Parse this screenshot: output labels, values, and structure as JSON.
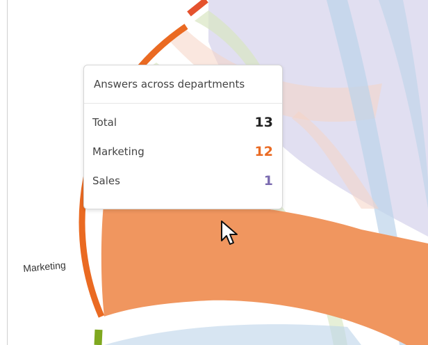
{
  "chart": {
    "arc_labels": [
      {
        "key": "marketing",
        "text": "Marketing"
      }
    ],
    "colors": {
      "marketing": "#ea6a22",
      "marketing_ribbon": "#f0965f",
      "sales": "#7b6bb0",
      "sales_ribbon": "#dcd9ef",
      "top_red": "#e4522e",
      "green": "#7fa81f",
      "green_ribbon": "#d9e6c2",
      "blue_ribbon": "#bcd3ea",
      "peach_ribbon": "#f6d4c4"
    }
  },
  "tooltip": {
    "title": "Answers across departments",
    "rows": [
      {
        "label": "Total",
        "value": "13",
        "color": "#222222"
      },
      {
        "label": "Marketing",
        "value": "12",
        "color": "#ea6a22"
      },
      {
        "label": "Sales",
        "value": "1",
        "color": "#7b6bb0"
      }
    ]
  }
}
